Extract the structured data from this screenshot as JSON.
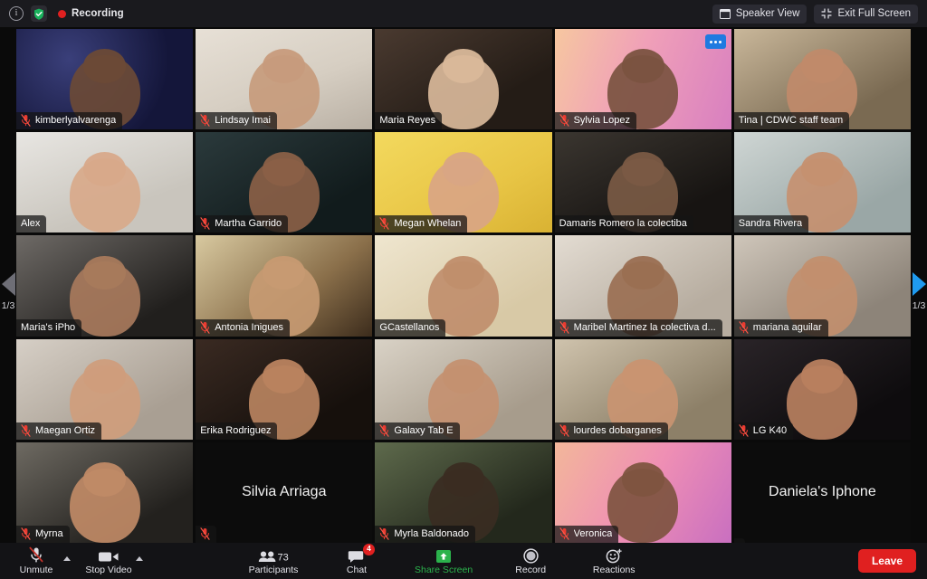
{
  "topbar": {
    "info_icon": "info-icon",
    "encryption_icon": "shield-check-icon",
    "recording_label": "Recording",
    "speaker_view_label": "Speaker View",
    "speaker_view_icon": "layout-icon",
    "exit_full_screen_label": "Exit Full Screen",
    "exit_full_screen_icon": "contract-arrows-icon"
  },
  "pager": {
    "prev_icon": "chevron-left-triangle-icon",
    "next_icon": "chevron-right-triangle-icon",
    "left_page": "1/3",
    "right_page": "1/3",
    "active_color": "#1f9bf0",
    "inactive_color": "#6e6e76"
  },
  "gallery": {
    "active_speaker_border": "#c6e84a",
    "more_options_icon": "ellipsis-icon",
    "muted_icon": "mic-muted-icon",
    "tiles": [
      {
        "name": "kimberlyalvarenga",
        "muted": true,
        "video": true,
        "active": false,
        "more": false,
        "bg": "stainedglass"
      },
      {
        "name": "Lindsay Imai",
        "muted": true,
        "video": true,
        "active": false,
        "more": false,
        "bg": "room-light"
      },
      {
        "name": "Maria Reyes",
        "muted": false,
        "video": true,
        "active": false,
        "more": false,
        "bg": "room-dark"
      },
      {
        "name": "Sylvia Lopez",
        "muted": true,
        "video": true,
        "active": false,
        "more": true,
        "bg": "virtual-pink"
      },
      {
        "name": "Tina | CDWC staff team",
        "muted": false,
        "video": true,
        "active": true,
        "more": false,
        "bg": "room-tan"
      },
      {
        "name": "Alex",
        "muted": false,
        "video": true,
        "active": false,
        "more": false,
        "bg": "room-white"
      },
      {
        "name": "Martha Garrido",
        "muted": true,
        "video": true,
        "active": false,
        "more": false,
        "bg": "room-teal"
      },
      {
        "name": "Megan Whelan",
        "muted": true,
        "video": true,
        "active": false,
        "more": false,
        "bg": "virtual-yellow"
      },
      {
        "name": "Damaris Romero la colectiba",
        "muted": false,
        "video": true,
        "active": false,
        "more": false,
        "bg": "room-dim"
      },
      {
        "name": "Sandra Rivera",
        "muted": false,
        "video": true,
        "active": false,
        "more": false,
        "bg": "room-blue"
      },
      {
        "name": "Maria's iPho",
        "muted": false,
        "video": true,
        "active": false,
        "more": false,
        "bg": "room-grey"
      },
      {
        "name": "Antonia Inigues",
        "muted": true,
        "video": true,
        "active": false,
        "more": false,
        "bg": "room-market"
      },
      {
        "name": "GCastellanos",
        "muted": false,
        "video": true,
        "active": false,
        "more": false,
        "bg": "room-cream"
      },
      {
        "name": "Maribel Martinez la colectiva d...",
        "muted": true,
        "video": true,
        "active": false,
        "more": false,
        "bg": "room-plant"
      },
      {
        "name": "mariana aguilar",
        "muted": true,
        "video": true,
        "active": false,
        "more": false,
        "bg": "room-stripe"
      },
      {
        "name": "Maegan Ortiz",
        "muted": true,
        "video": true,
        "active": false,
        "more": false,
        "bg": "room-art"
      },
      {
        "name": "Erika Rodriguez",
        "muted": false,
        "video": true,
        "active": false,
        "more": false,
        "bg": "room-brown"
      },
      {
        "name": "Galaxy Tab E",
        "muted": true,
        "video": true,
        "active": false,
        "more": false,
        "bg": "room-flowers"
      },
      {
        "name": "lourdes dobarganes",
        "muted": true,
        "video": true,
        "active": false,
        "more": false,
        "bg": "room-hall"
      },
      {
        "name": "LG K40",
        "muted": true,
        "video": true,
        "active": false,
        "more": false,
        "bg": "room-pink"
      },
      {
        "name": "Myrna",
        "muted": true,
        "video": true,
        "active": false,
        "more": false,
        "bg": "room-kids"
      },
      {
        "name": "Silvia Arriaga",
        "muted": true,
        "video": false,
        "active": false,
        "more": false,
        "bg": "none"
      },
      {
        "name": "Myrla Baldonado",
        "muted": true,
        "video": true,
        "active": false,
        "more": false,
        "bg": "room-hat"
      },
      {
        "name": "Veronica",
        "muted": true,
        "video": true,
        "active": false,
        "more": false,
        "bg": "virtual-pink2"
      },
      {
        "name": "Daniela's Iphone",
        "muted": false,
        "video": false,
        "active": false,
        "more": false,
        "bg": "none"
      }
    ]
  },
  "toolbar": {
    "unmute_label": "Unmute",
    "unmute_icon": "mic-muted-icon",
    "stop_video_label": "Stop Video",
    "stop_video_icon": "camera-icon",
    "participants_label": "Participants",
    "participants_icon": "people-icon",
    "participants_count": "73",
    "chat_label": "Chat",
    "chat_icon": "chat-bubble-icon",
    "chat_badge": "4",
    "share_screen_label": "Share Screen",
    "share_screen_icon": "share-up-arrow-icon",
    "share_screen_color": "#2bb24c",
    "record_label": "Record",
    "record_icon": "record-circle-icon",
    "reactions_label": "Reactions",
    "reactions_icon": "smiley-plus-icon",
    "leave_label": "Leave",
    "leave_color": "#e02020"
  }
}
